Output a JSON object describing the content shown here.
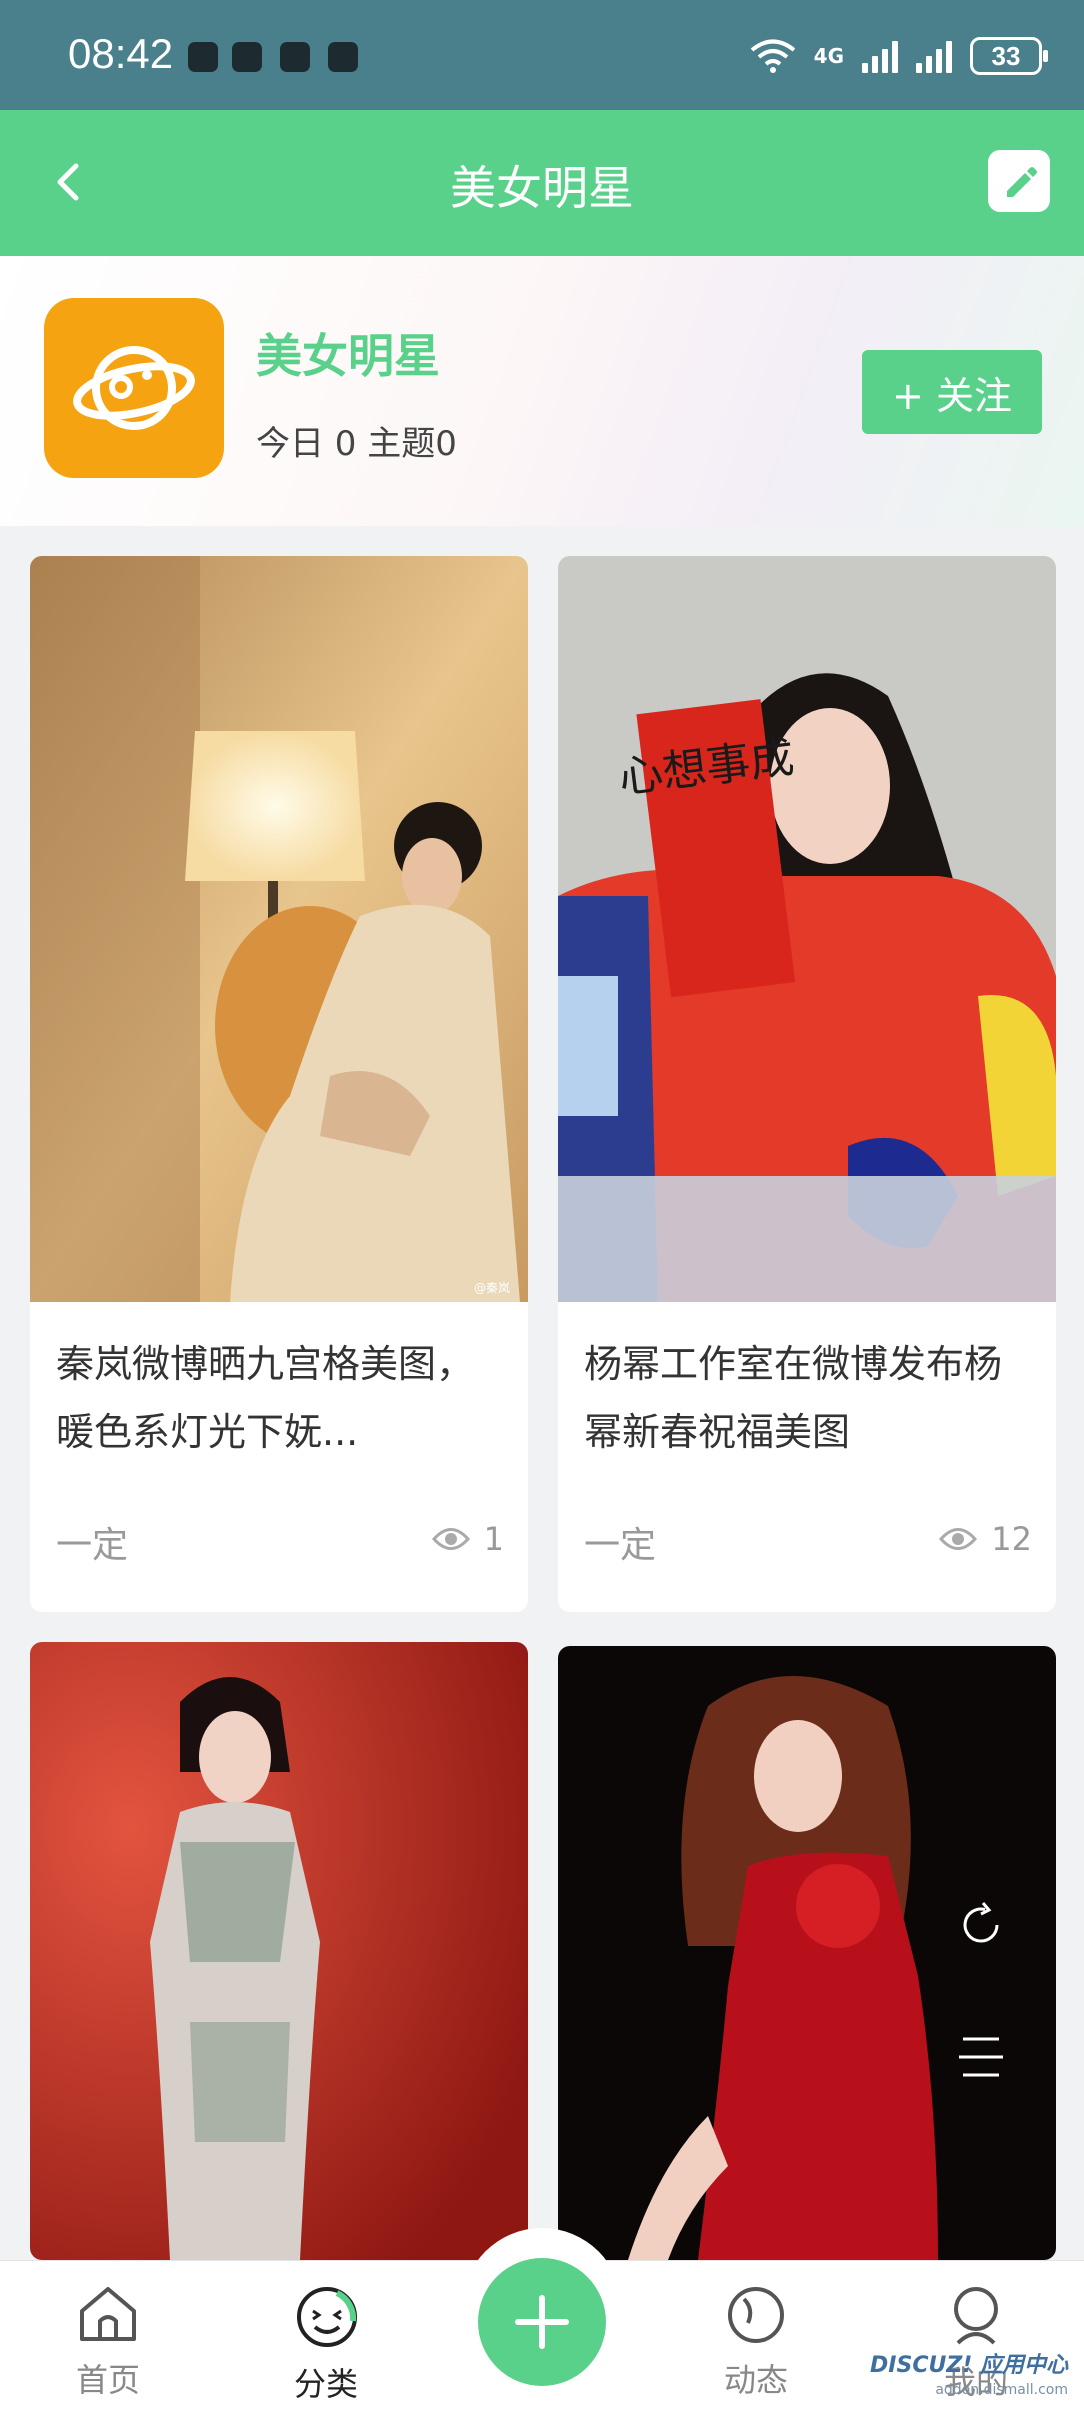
{
  "status_bar": {
    "time": "08:42",
    "network": "4G",
    "battery": "33"
  },
  "header": {
    "title": "美女明星"
  },
  "forum": {
    "name": "美女明星",
    "stats": "今日 0 主题0",
    "follow_label": "+ 关注"
  },
  "posts": [
    {
      "title": "秦岚微博晒九宫格美图，暖色系灯光下妩...",
      "author": "一定",
      "views": "1",
      "photo_caption": "@秦岚"
    },
    {
      "title": "杨幂工作室在微博发布杨幂新春祝福美图",
      "author": "一定",
      "views": "12",
      "photo_caption": "心想事成"
    },
    {
      "title": "",
      "author": "",
      "views": ""
    },
    {
      "title": "",
      "author": "",
      "views": ""
    }
  ],
  "nav": [
    {
      "label": "首页"
    },
    {
      "label": "分类"
    },
    {
      "label": ""
    },
    {
      "label": "动态"
    },
    {
      "label": "我的"
    }
  ],
  "watermark": {
    "brand": "DISCUZ! 应用中心",
    "url": "addon.dismall.com"
  },
  "colors": {
    "accent": "#5ad18b",
    "status_bar": "#4a7f8c",
    "forum_logo": "#f6a312"
  }
}
